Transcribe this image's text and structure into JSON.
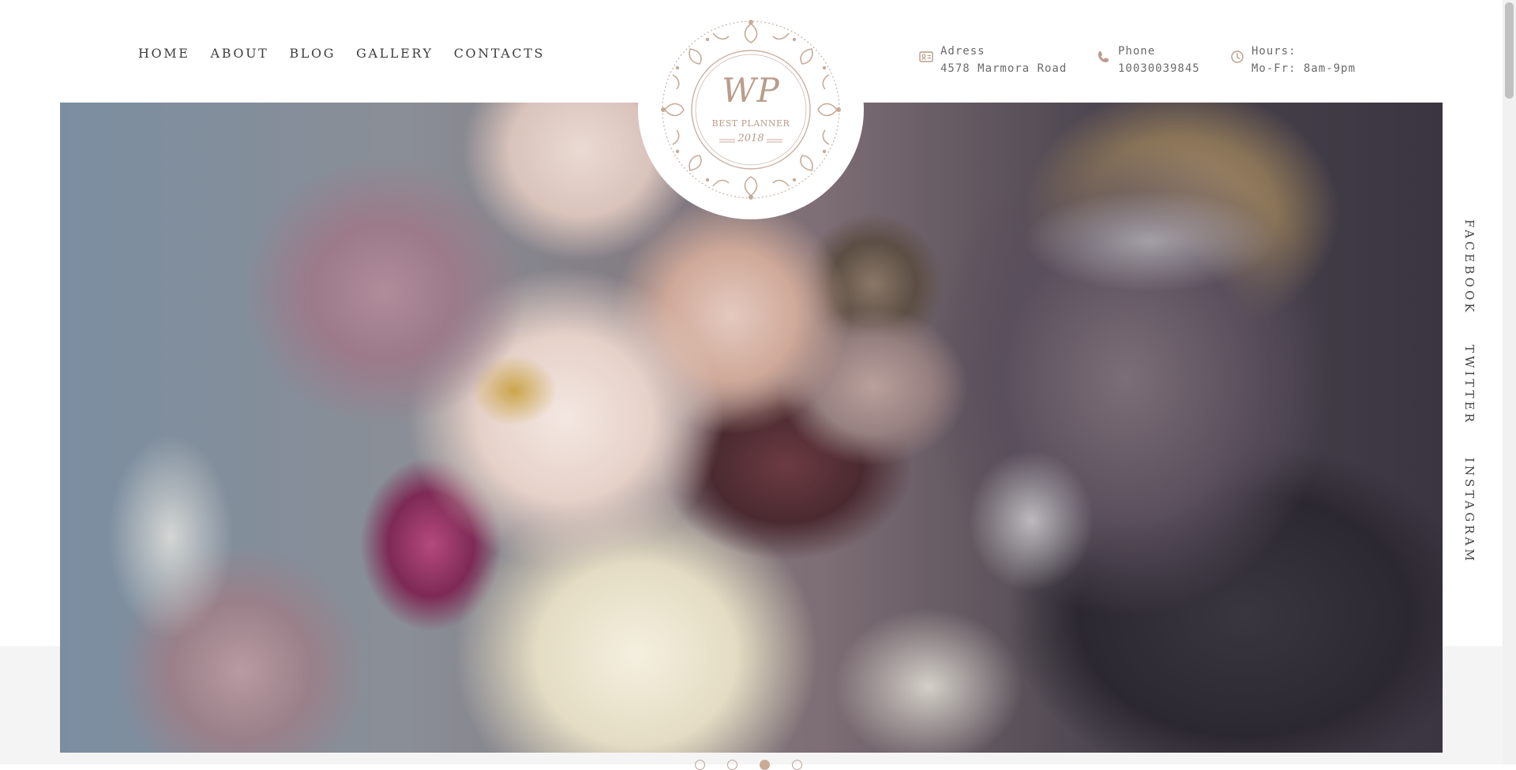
{
  "nav": {
    "items": [
      {
        "label": "HOME"
      },
      {
        "label": "ABOUT"
      },
      {
        "label": "BLOG"
      },
      {
        "label": "GALLERY"
      },
      {
        "label": "CONTACTS"
      }
    ]
  },
  "logo": {
    "monogram": "WP",
    "subtitle": "BEST PLANNER",
    "year": "2018",
    "icon": "floral-wreath-logo"
  },
  "contact": {
    "address": {
      "label": "Adress",
      "value": "4578 Marmora Road",
      "icon": "id-card-icon"
    },
    "phone": {
      "label": "Phone",
      "value": "10030039845",
      "icon": "phone-icon"
    },
    "hours": {
      "label": "Hours:",
      "value": "Mo-Fr: 8am-9pm",
      "icon": "clock-icon"
    }
  },
  "social": {
    "facebook": "FACEBOOK",
    "twitter": "TWITTER",
    "instagram": "INSTAGRAM"
  },
  "slider": {
    "slide_count": 4,
    "active_slide": 3
  },
  "colors": {
    "accent": "#b99c8a",
    "text": "#3d3d3d",
    "band": "#f4f4f4"
  }
}
